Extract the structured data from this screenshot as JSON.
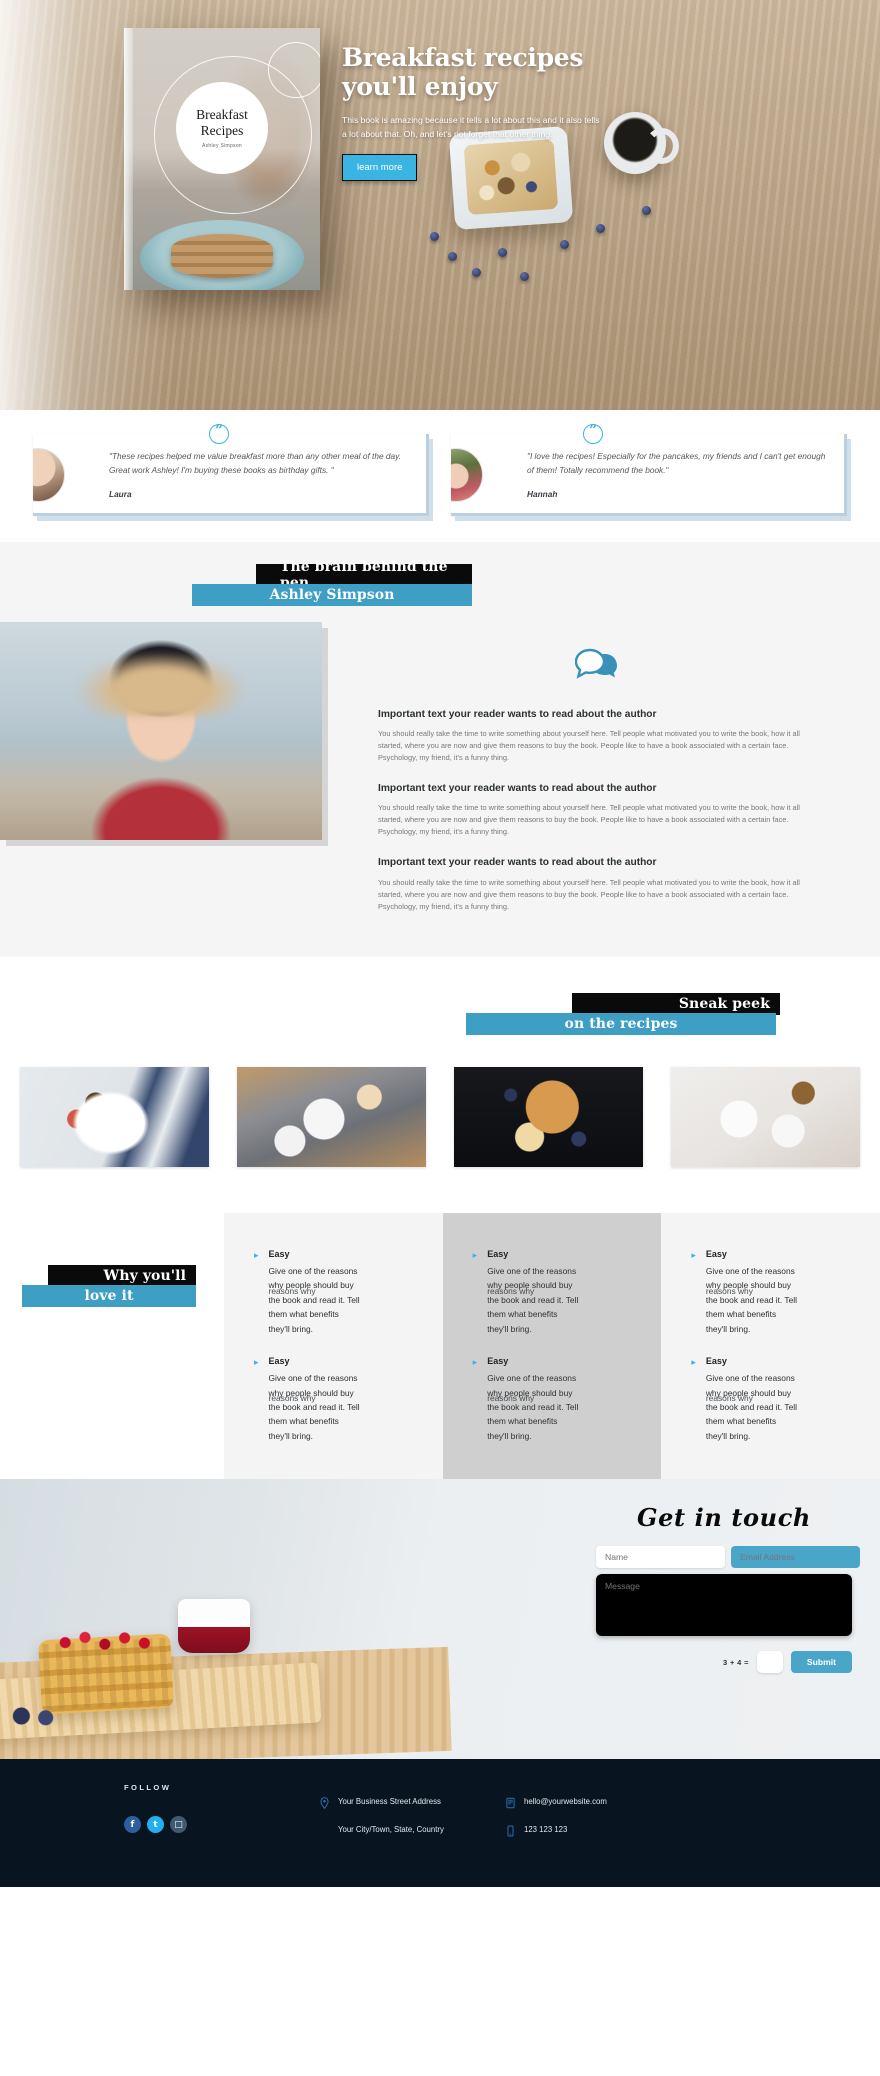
{
  "hero": {
    "book_cover": {
      "title_line1": "Breakfast",
      "title_line2": "Recipes",
      "author": "Ashley Simpson"
    },
    "title": "Breakfast recipes you'll enjoy",
    "paragraph": "This book is amazing because it tells a lot about this and it also tells a lot about that. Oh, and let's not forget\nthat other thing.",
    "cta_label": "learn more",
    "accent_color": "#3ab4e2"
  },
  "testimonials": [
    {
      "quote": "\"These recipes helped me value breakfast more than any other meal of the day. Great work Ashley! I'm buying these books as birthday gifts. \"",
      "name": "Laura",
      "quote_icon": "quote-icon"
    },
    {
      "quote": "\"I love the recipes! Especially for the pancakes, my friends and I can't get enough of them! Totally recommend the book.\"",
      "name": "Hannah",
      "quote_icon": "quote-icon"
    }
  ],
  "author_section": {
    "heading_black": "The brain behind the pen",
    "heading_blue": "Ashley Simpson",
    "chat_icon": "chat-bubble-icon",
    "blocks": [
      {
        "title": "Important text your reader wants to read about the author",
        "body": "You should really take the time to write something about yourself here. Tell people what motivated you to write the book, how it all started, where you are now and give them reasons to buy the book. People like to have a book associated with a certain face. Psychology, my friend, it's a funny thing."
      },
      {
        "title": "Important text your reader wants to read about the author",
        "body": "You should really take the time to write something about yourself here. Tell people what motivated you to write the book, how it all started, where you are now and give them reasons to buy the book. People like to have a book associated with a certain face. Psychology, my friend, it's a funny thing."
      },
      {
        "title": "Important text your reader wants to read about the author",
        "body": "You should really take the time to write something about yourself here. Tell people what motivated you to write the book, how it all started, where you are now and give them reasons to buy the book. People like to have a book associated with a certain face. Psychology, my friend, it's a funny thing."
      }
    ]
  },
  "sneak_peek": {
    "heading_black": "Sneak peek",
    "heading_blue": "on the recipes",
    "gallery": [
      {
        "alt": "breakfast-plate-eggs-toast"
      },
      {
        "alt": "brunch-table-overhead"
      },
      {
        "alt": "french-toast-banana-blueberry"
      },
      {
        "alt": "granola-bowls-marble-table"
      }
    ]
  },
  "why_section": {
    "heading_black": "Why you'll",
    "heading_blue": "love it",
    "columns": [
      {
        "features": [
          {
            "title": "Easy",
            "body": "Give one of the reasons why people should buy the book and read it. Tell them what benefits they'll bring.",
            "ghost": "reasons why"
          },
          {
            "title": "Easy",
            "body": "Give one of the reasons why people should buy the book and read it. Tell them what benefits they'll bring.",
            "ghost": "reasons why"
          }
        ]
      },
      {
        "features": [
          {
            "title": "Easy",
            "body": "Give one of the reasons why people should buy the book and read it. Tell them what benefits they'll bring.",
            "ghost": "reasons why"
          },
          {
            "title": "Easy",
            "body": "Give one of the reasons why people should buy the book and read it. Tell them what benefits they'll bring.",
            "ghost": "reasons why"
          }
        ]
      },
      {
        "features": [
          {
            "title": "Easy",
            "body": "Give one of the reasons why people should buy the book and read it. Tell them what benefits they'll bring.",
            "ghost": "reasons why"
          },
          {
            "title": "Easy",
            "body": "Give one of the reasons why people should buy the book and read it. Tell them what benefits they'll bring.",
            "ghost": "reasons why"
          }
        ]
      }
    ]
  },
  "contact": {
    "title": "Get in touch",
    "name_placeholder": "Name",
    "email_placeholder": "Email Address",
    "message_placeholder": "Message",
    "captcha_label": "3 + 4 =",
    "captcha_value": "",
    "submit_label": "Submit"
  },
  "footer": {
    "follow_label": "FOLLOW",
    "socials": [
      {
        "name": "facebook",
        "glyph": "f"
      },
      {
        "name": "twitter",
        "glyph": "t"
      },
      {
        "name": "instagram",
        "glyph": "□"
      }
    ],
    "address_line1": "Your Business Street Address",
    "address_line2": "Your City/Town, State, Country",
    "email": "hello@yourwebsite.com",
    "phone": "123 123 123",
    "location_icon": "map-pin-icon",
    "email_icon": "mail-icon",
    "phone_icon": "phone-icon"
  }
}
